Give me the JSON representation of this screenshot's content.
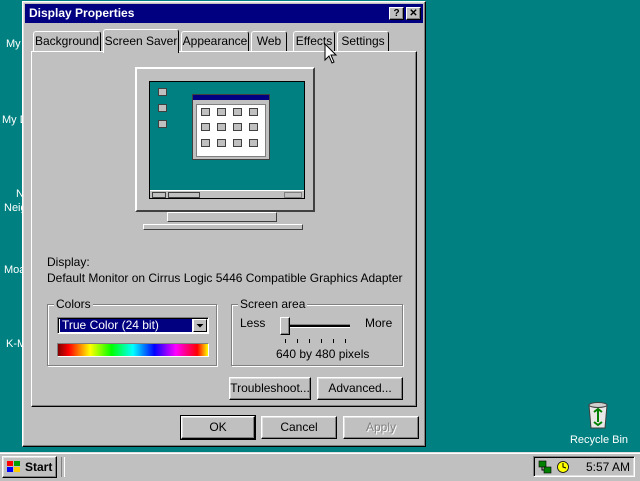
{
  "desktop": {
    "icons": [
      {
        "label": "My"
      },
      {
        "label": "My D"
      },
      {
        "label": "N"
      },
      {
        "label": "Neig"
      },
      {
        "label": "Moa"
      },
      {
        "label": "K-M"
      }
    ],
    "recycle_bin": {
      "label": "Recycle Bin",
      "icon": "recycle-bin-icon"
    }
  },
  "window": {
    "title": "Display Properties",
    "help_glyph": "?",
    "close_glyph": "✕",
    "tabs": [
      {
        "label": "Background"
      },
      {
        "label": "Screen Saver"
      },
      {
        "label": "Appearance"
      },
      {
        "label": "Web"
      },
      {
        "label": "Effects"
      },
      {
        "label": "Settings"
      }
    ],
    "active_tab": "Screen Saver",
    "display_label": "Display:",
    "display_value": "Default Monitor on Cirrus Logic 5446 Compatible Graphics Adapter",
    "colors_group": {
      "title": "Colors",
      "selected": "True Color (24 bit)"
    },
    "screen_area_group": {
      "title": "Screen area",
      "less_label": "Less",
      "more_label": "More",
      "resolution_text": "640 by 480 pixels",
      "slider_position": 0
    },
    "buttons": {
      "troubleshoot": "Troubleshoot...",
      "advanced": "Advanced...",
      "ok": "OK",
      "cancel": "Cancel",
      "apply": "Apply"
    }
  },
  "taskbar": {
    "start_label": "Start",
    "clock": "5:57 AM"
  },
  "colors": {
    "desktop": "#008080",
    "titlebar": "#000080",
    "face": "#c0c0c0",
    "selection": "#000080"
  }
}
